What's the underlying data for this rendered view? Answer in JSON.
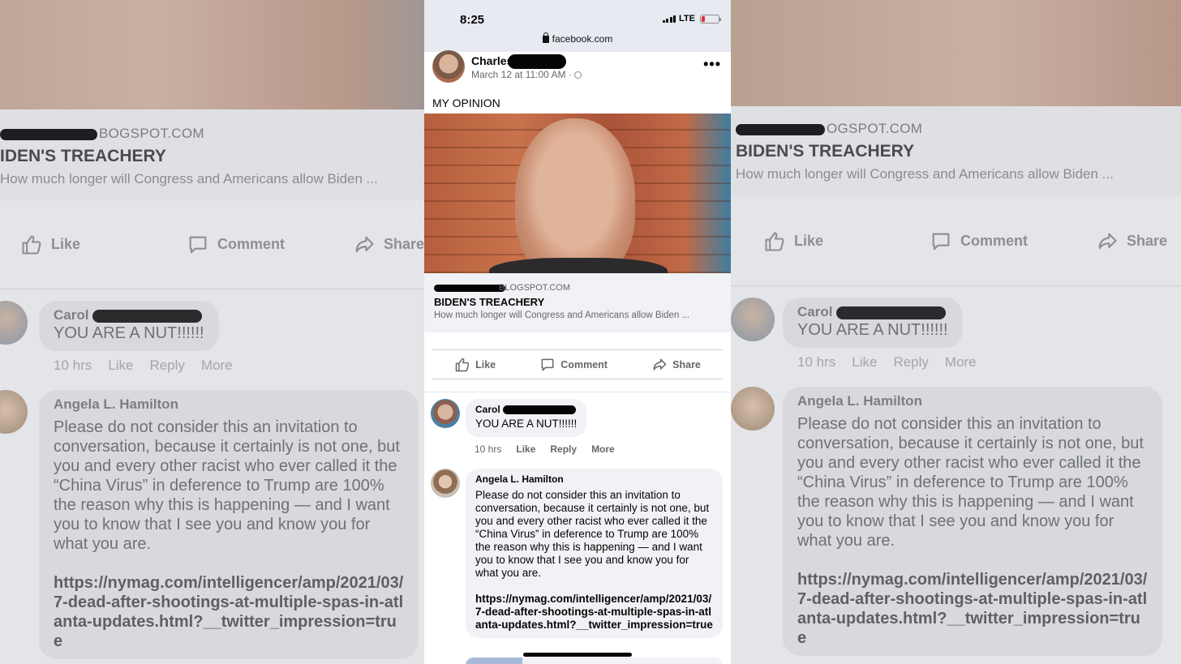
{
  "status_bar": {
    "time": "8:25",
    "network": "LTE",
    "url": "facebook.com"
  },
  "post": {
    "author_first_name": "Charles",
    "timestamp": "March 12 at 11:00 AM ·",
    "text": "MY OPINION",
    "link_card": {
      "domain": "BLOGSPOT.COM",
      "domain_background": "OGSPOT.COM",
      "title": "BIDEN'S TREACHERY",
      "description": "How much longer will Congress and Americans allow Biden ..."
    },
    "actions": {
      "like": "Like",
      "comment": "Comment",
      "share": "Share"
    }
  },
  "comments": [
    {
      "author": "Carol",
      "text": "YOU ARE A NUT!!!!!!",
      "time": "10 hrs",
      "like": "Like",
      "reply": "Reply",
      "more": "More"
    },
    {
      "author": "Angela L. Hamilton",
      "text": "Please do not consider this an invitation to conversation, because it certainly is not one, but you and every other racist who ever called it the “China Virus” in deference to Trump are 100% the reason why this is happening — and I want you to know that I see you and know you for what you are.",
      "link": "https://nymag.com/intelligencer/amp/2021/03/7-dead-after-shootings-at-multiple-spas-in-atlanta-updates.html?__twitter_impression=true"
    }
  ],
  "background_left": {
    "domain": "BOGSPOT.COM",
    "title": "IDEN'S TREACHERY",
    "description": "How much longer will Congress and Americans allow Biden ..."
  },
  "colors": {
    "fb_gray_text": "#65676b",
    "bubble_bg": "#f0f2f5",
    "status_bar_bg": "#e8eaf2",
    "battery_low": "#e0303a"
  },
  "icons": [
    "lock-icon",
    "signal-icon",
    "battery-icon",
    "globe-icon",
    "more-icon",
    "like-icon",
    "comment-icon",
    "share-icon"
  ]
}
